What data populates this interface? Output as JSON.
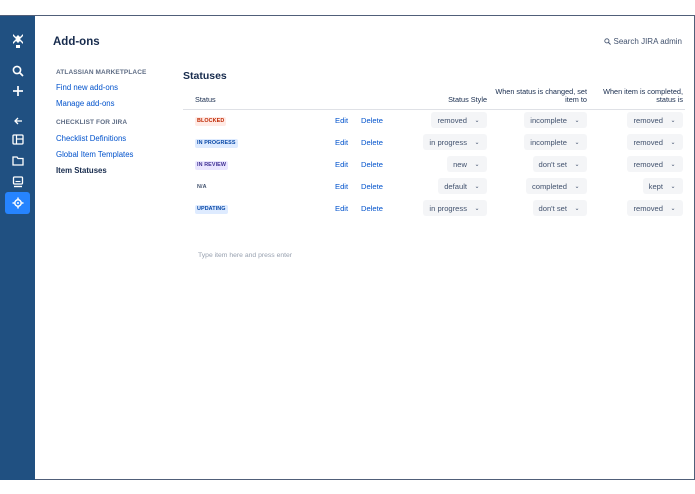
{
  "page": {
    "title": "Add-ons",
    "search_label": "Search JIRA admin"
  },
  "globalnav": {
    "icons": [
      "jira-logo-icon",
      "search-icon",
      "create-plus-icon",
      "back-arrow-icon",
      "board-icon",
      "folder-icon",
      "dashboard-icon",
      "settings-gear-icon"
    ]
  },
  "sidebar": {
    "marketplace_heading": "ATLASSIAN MARKETPLACE",
    "find_new": "Find new add-ons",
    "manage": "Manage add-ons",
    "checklist_heading": "CHECKLIST FOR JIRA",
    "checklist_definitions": "Checklist Definitions",
    "global_templates": "Global Item Templates",
    "item_statuses": "Item Statuses"
  },
  "statuses": {
    "title": "Statuses",
    "headers": {
      "status": "Status",
      "style": "Status Style",
      "changed": "When status is changed, set item to",
      "completed": "When item is completed, status is"
    },
    "edit_label": "Edit",
    "delete_label": "Delete",
    "rows": [
      {
        "name": "BLOCKED",
        "style": "removed",
        "changed": "incomplete",
        "completed": "removed"
      },
      {
        "name": "IN PROGRESS",
        "style": "in progress",
        "changed": "incomplete",
        "completed": "removed"
      },
      {
        "name": "IN REVIEW",
        "style": "new",
        "changed": "don't set",
        "completed": "removed"
      },
      {
        "name": "N/A",
        "style": "default",
        "changed": "completed",
        "completed": "kept"
      },
      {
        "name": "UPDATING",
        "style": "in progress",
        "changed": "don't set",
        "completed": "removed"
      }
    ],
    "add_placeholder": "Type item here and press enter"
  }
}
